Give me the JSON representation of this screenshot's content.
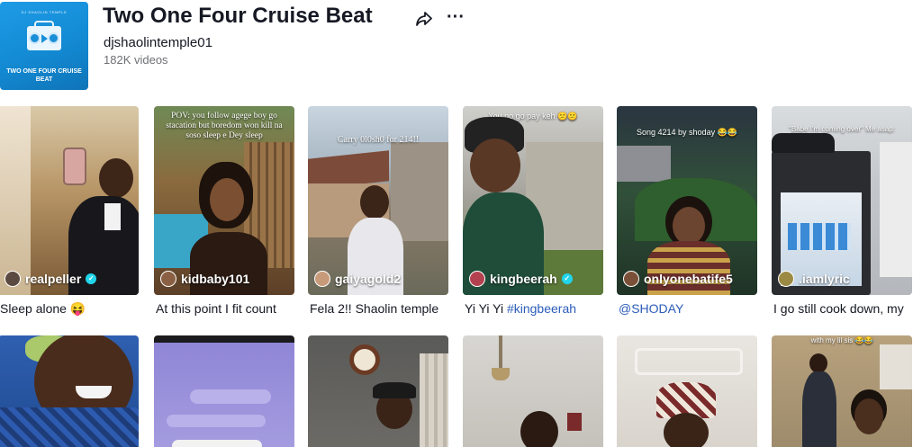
{
  "sound": {
    "cover_top_text": "DJ SHAOLIN TEMPLE",
    "cover_title": "TWO ONE FOUR CRUISE BEAT",
    "title": "Two One Four Cruise Beat",
    "author": "djshaolintemple01",
    "video_count": "182K videos",
    "share_icon": "share-arrow-icon",
    "more_icon": "more-dots-icon",
    "more_glyph": "···"
  },
  "colors": {
    "text": "#161823",
    "secondary": "#6f7075",
    "hashtag": "#2b5db9",
    "verified": "#20d5ec"
  },
  "videos": [
    {
      "creator": "realpeller",
      "verified": true,
      "caption_text": "Sleep alone ",
      "caption_emoji": "😝",
      "caption_tag": "",
      "overlay": ""
    },
    {
      "creator": "kidbaby101",
      "verified": false,
      "caption_text": "At this point I fit count",
      "caption_emoji": "",
      "caption_tag": "",
      "overlay": "POV: you follow agege boy go stacation but boredom won kill na soso sleep e Dey sleep"
    },
    {
      "creator": "gaiyagold2",
      "verified": false,
      "caption_text": "Fela 2!! Shaolin temple",
      "caption_emoji": "",
      "caption_tag": "",
      "overlay": "Carry 0l0sh0 for 214!!"
    },
    {
      "creator": "kingbeerah",
      "verified": true,
      "caption_text": "Yi Yi Yi ",
      "caption_emoji": "",
      "caption_tag": "#kingbeerah",
      "overlay": "You no go pay keh 😕😕"
    },
    {
      "creator": "onlyonebatife5",
      "verified": false,
      "caption_text": "",
      "caption_emoji": "",
      "caption_tag": "@SHODAY",
      "overlay": "Song 4214 by shoday 😂😂"
    },
    {
      "creator": ".iamlyric",
      "verified": false,
      "caption_text": "I go still cook down, my",
      "caption_emoji": "",
      "caption_tag": "",
      "overlay": "\"Babe I'm coming over\" Me asap:"
    }
  ],
  "videos_row2": [
    {
      "overlay": ""
    },
    {
      "overlay": ""
    },
    {
      "overlay": ""
    },
    {
      "overlay": ""
    },
    {
      "overlay": ""
    },
    {
      "overlay": "with my lil sis 😂😂"
    }
  ]
}
